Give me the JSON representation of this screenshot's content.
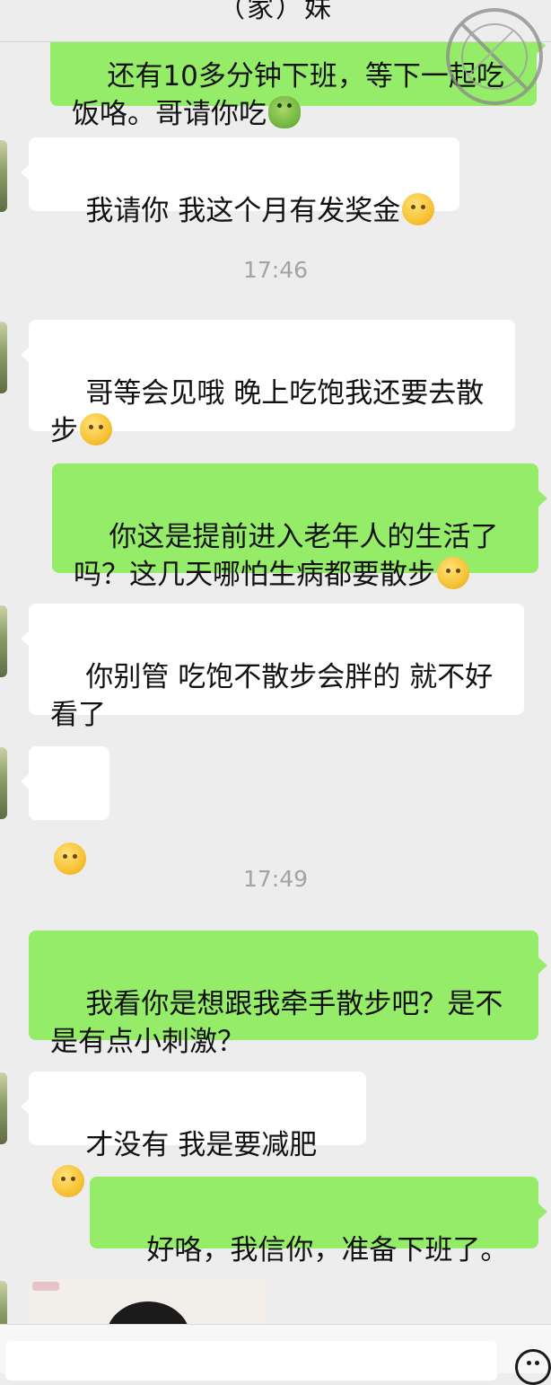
{
  "header": {
    "title": "（家）妹"
  },
  "messages": [
    {
      "side": "out",
      "text": "还有10多分钟下班，等下一起吃饭咯。哥请你吃",
      "emoji": "frog-emoji"
    },
    {
      "side": "in",
      "text": "我请你 我这个月有发奖金",
      "emoji": "blush-emoji"
    },
    {
      "side": "time",
      "text": "17:46"
    },
    {
      "side": "in",
      "text": "哥等会见哦 晚上吃饱我还要去散步",
      "emoji": "hand-over-mouth-emoji"
    },
    {
      "side": "out",
      "text": "你这是提前进入老年人的生活了吗？这几天哪怕生病都要散步",
      "emoji": "kissing-emoji"
    },
    {
      "side": "in",
      "text": "你别管 吃饱不散步会胖的 就不好看了"
    },
    {
      "side": "in",
      "text": "",
      "emoji": "blush-emoji"
    },
    {
      "side": "time",
      "text": "17:49"
    },
    {
      "side": "out",
      "text": "我看你是想跟我牵手散步吧？是不是有点小刺激？"
    },
    {
      "side": "in",
      "text": "才没有 我是要减肥",
      "emoji": "hand-over-mouth-emoji"
    },
    {
      "side": "out",
      "text": "好咯，我信你，准备下班了。"
    }
  ],
  "icons": {
    "avatar": "contact-avatar",
    "stamp": "watermark-stamp",
    "emoji_button": "emoji-icon"
  }
}
